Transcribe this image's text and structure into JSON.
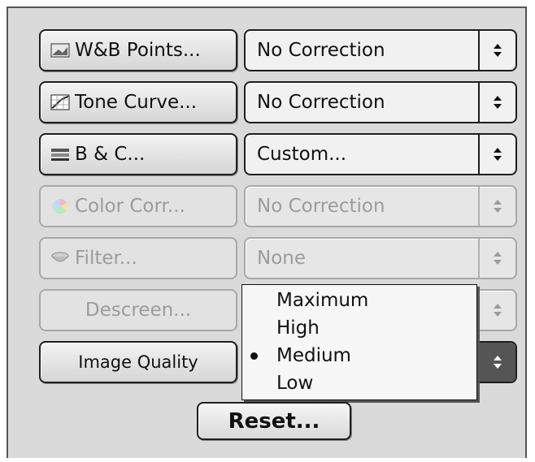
{
  "rows": [
    {
      "button": "W&B Points...",
      "button_icon": "wb-points-icon",
      "select": "No Correction",
      "enabled": true
    },
    {
      "button": "Tone Curve...",
      "button_icon": "tone-curve-icon",
      "select": "No Correction",
      "enabled": true
    },
    {
      "button": "B & C...",
      "button_icon": "brightness-contrast-icon",
      "select": "Custom...",
      "enabled": true
    },
    {
      "button": "Color Corr...",
      "button_icon": "color-wheel-icon",
      "select": "No Correction",
      "enabled": false
    },
    {
      "button": "Filter...",
      "button_icon": "filter-icon",
      "select": "None",
      "enabled": false
    },
    {
      "button": "Descreen...",
      "button_icon": "",
      "select": "",
      "enabled": false
    },
    {
      "button": "Image Quality",
      "button_icon": "",
      "select": "",
      "enabled": true
    }
  ],
  "quality_menu": {
    "options": [
      "Maximum",
      "High",
      "Medium",
      "Low"
    ],
    "selected": "Medium"
  },
  "reset_label": "Reset..."
}
